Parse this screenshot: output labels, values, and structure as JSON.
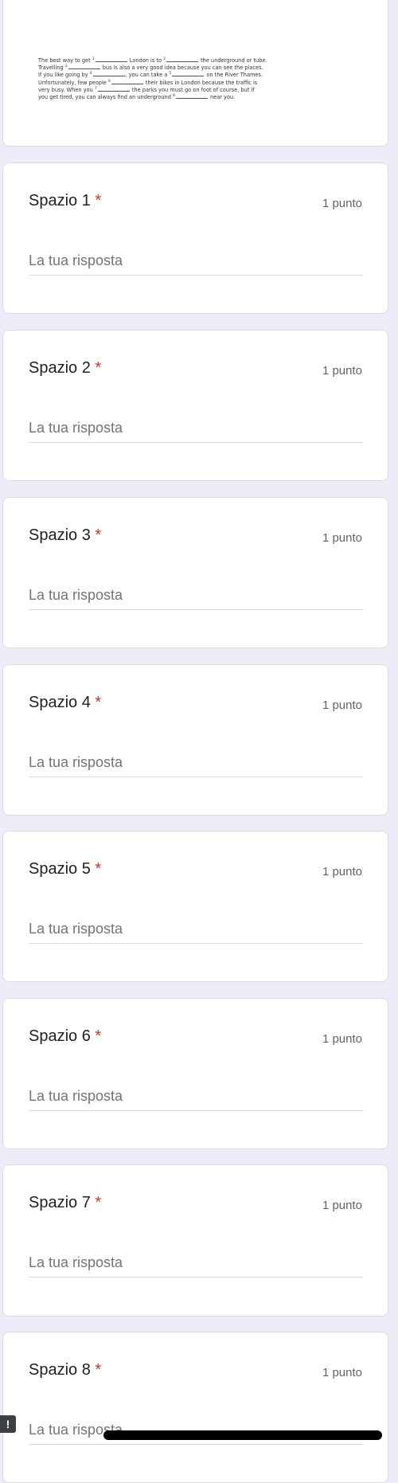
{
  "passage": {
    "lines": [
      [
        "The best way to get ",
        "1",
        " London is to ",
        "2",
        " the underground or tube."
      ],
      [
        "Travelling ",
        "3",
        " bus is also a very good idea because you can see the places."
      ],
      [
        "If you like going by ",
        "4",
        ", you can take a ",
        "5",
        " on the River Thames."
      ],
      [
        "Unfortunately, few people ",
        "6",
        " their bikes in London because the traffic is"
      ],
      [
        "very busy. When you ",
        "7",
        " the parks you must go on foot of course, but if"
      ],
      [
        "you get tired, you can always find an underground ",
        "8",
        " near you."
      ]
    ]
  },
  "questions": [
    {
      "title": "Spazio 1",
      "required_mark": "*",
      "points": "1 punto",
      "placeholder": "La tua risposta"
    },
    {
      "title": "Spazio 2",
      "required_mark": "*",
      "points": "1 punto",
      "placeholder": "La tua risposta"
    },
    {
      "title": "Spazio 3",
      "required_mark": "*",
      "points": "1 punto",
      "placeholder": "La tua risposta"
    },
    {
      "title": "Spazio 4",
      "required_mark": "*",
      "points": "1 punto",
      "placeholder": "La tua risposta"
    },
    {
      "title": "Spazio 5",
      "required_mark": "*",
      "points": "1 punto",
      "placeholder": "La tua risposta"
    },
    {
      "title": "Spazio 6",
      "required_mark": "*",
      "points": "1 punto",
      "placeholder": "La tua risposta"
    },
    {
      "title": "Spazio 7",
      "required_mark": "*",
      "points": "1 punto",
      "placeholder": "La tua risposta"
    },
    {
      "title": "Spazio 8",
      "required_mark": "*",
      "points": "1 punto",
      "placeholder": "La tua risposta"
    }
  ],
  "warning_icon": {
    "icon": "exclamation-icon",
    "glyph": "!"
  },
  "colors": {
    "background": "#f0ebf8",
    "required": "#d93025",
    "card": "#ffffff"
  }
}
